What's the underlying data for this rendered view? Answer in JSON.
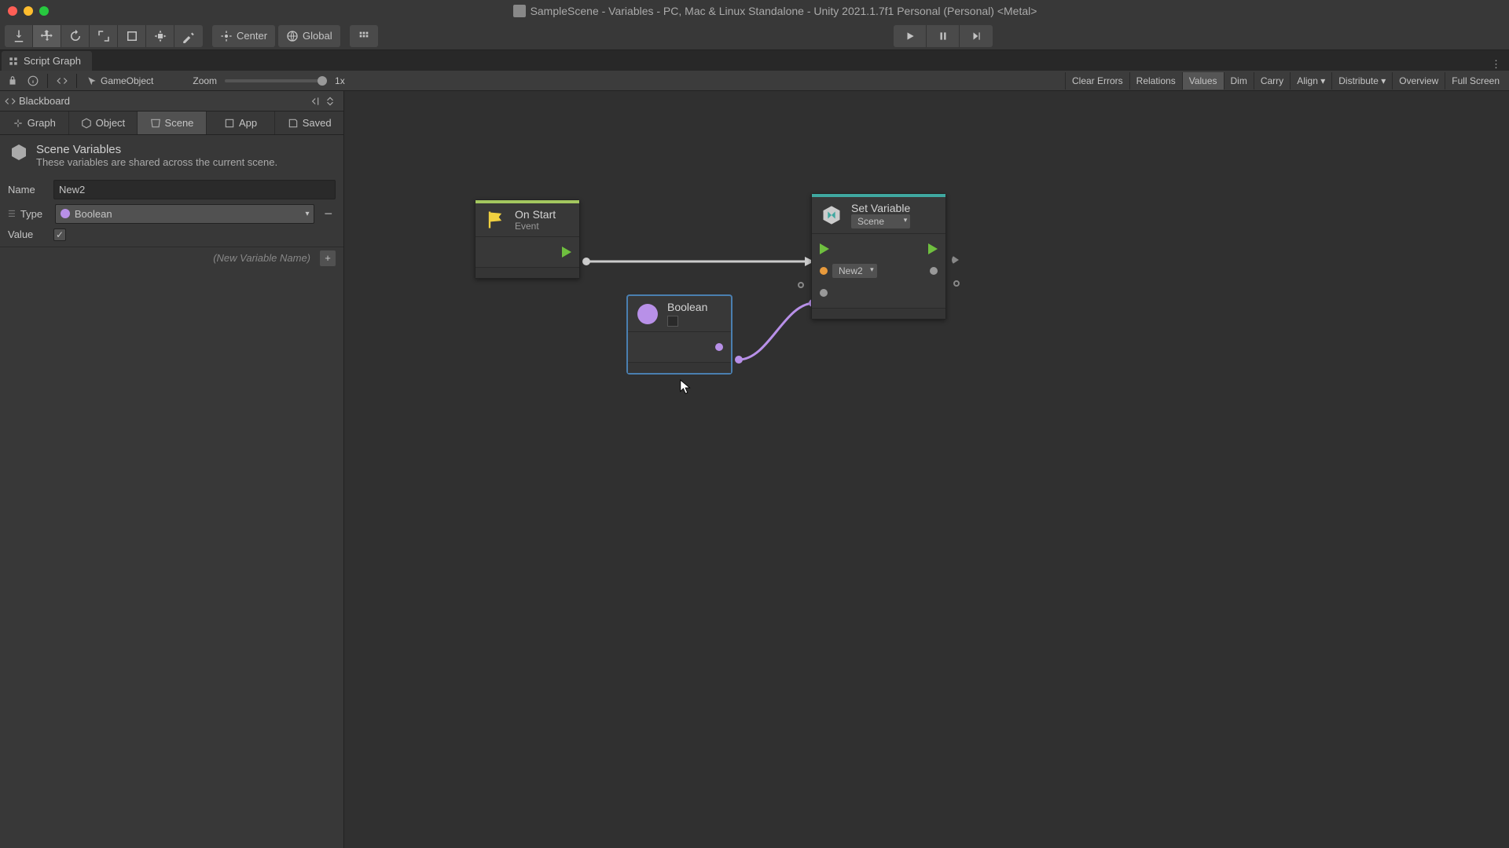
{
  "window": {
    "title": "SampleScene - Variables - PC, Mac & Linux Standalone - Unity 2021.1.7f1 Personal (Personal) <Metal>"
  },
  "toolbar": {
    "center_label": "Center",
    "global_label": "Global"
  },
  "tab": {
    "label": "Script Graph"
  },
  "graph_toolbar": {
    "gameobject_label": "GameObject",
    "zoom_label": "Zoom",
    "zoom_value": "1x",
    "right_buttons": {
      "clear_errors": "Clear Errors",
      "relations": "Relations",
      "values": "Values",
      "dim": "Dim",
      "carry": "Carry",
      "align": "Align",
      "distribute": "Distribute",
      "overview": "Overview",
      "full_screen": "Full Screen"
    }
  },
  "blackboard": {
    "title": "Blackboard",
    "tabs": {
      "graph": "Graph",
      "object": "Object",
      "scene": "Scene",
      "app": "App",
      "saved": "Saved"
    },
    "info": {
      "title": "Scene Variables",
      "desc": "These variables are shared across the current scene."
    },
    "var": {
      "name_label": "Name",
      "name_value": "New2",
      "type_label": "Type",
      "type_value": "Boolean",
      "value_label": "Value",
      "value_checked": true
    },
    "new_var_placeholder": "(New Variable Name)"
  },
  "nodes": {
    "on_start": {
      "title": "On Start",
      "subtitle": "Event"
    },
    "boolean": {
      "title": "Boolean"
    },
    "set_variable": {
      "title": "Set Variable",
      "scope": "Scene",
      "var_name": "New2"
    }
  }
}
